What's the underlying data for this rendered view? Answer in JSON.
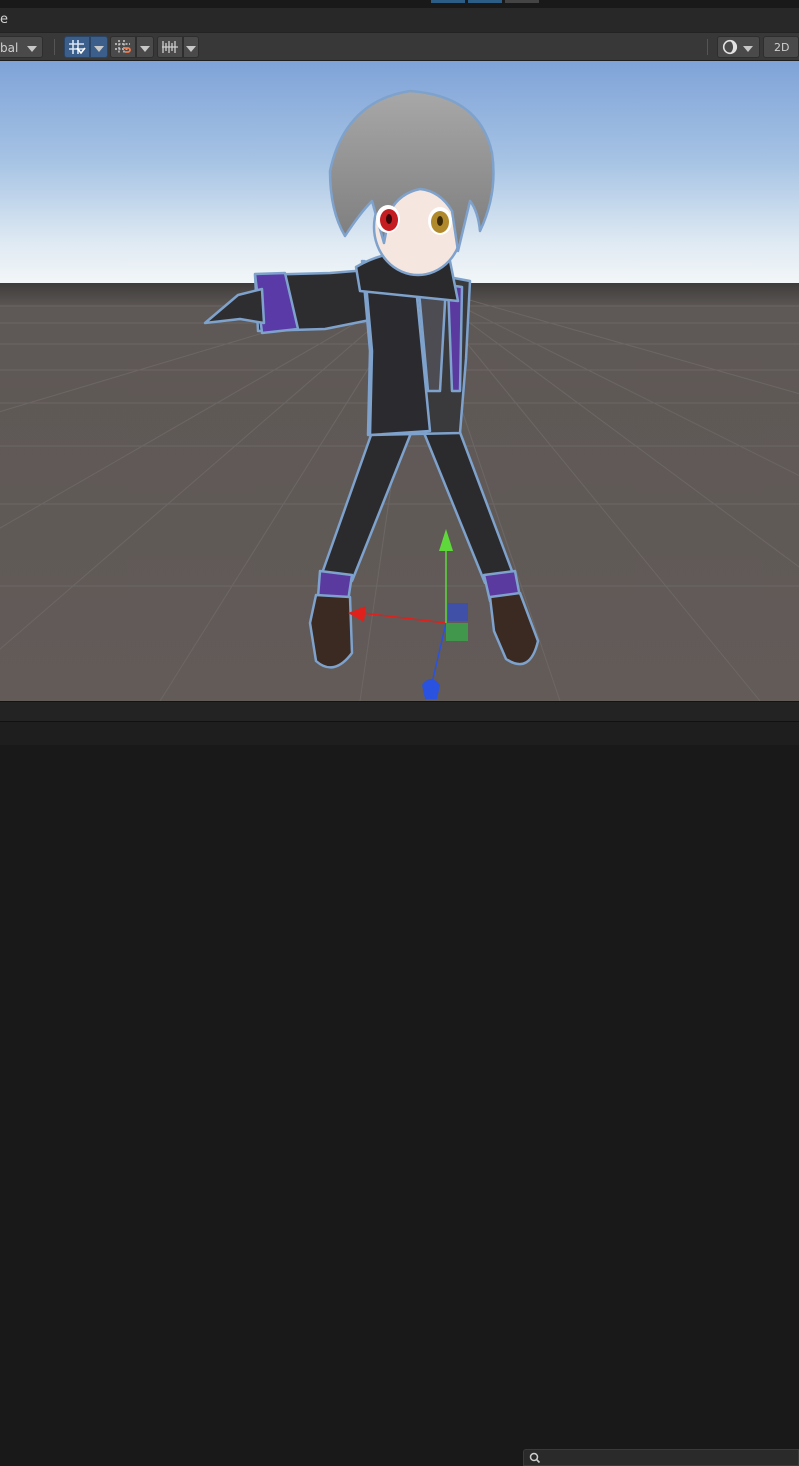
{
  "window": {
    "tab_title": "e"
  },
  "toolbar": {
    "pivot_rotation_label": "bal",
    "twod_label": "2D"
  },
  "search": {
    "placeholder": ""
  },
  "icons": {
    "grid_snap": "grid-snap-icon",
    "increment_snap": "increment-snap-icon",
    "view_tool_overlay": "overlay-icon",
    "shading": "shading-mode-icon",
    "search": "search-icon",
    "gizmo_x": "x-axis-arrow",
    "gizmo_y": "y-axis-arrow",
    "gizmo_z": "z-axis-arrow"
  },
  "colors": {
    "toolbar_bg": "#383838",
    "active_button": "#3c5e8a",
    "sky_top": "#7fa3d8",
    "horizon": "#eef4f8",
    "ground": "#5f5957",
    "gizmo_x": "#e0201b",
    "gizmo_y": "#5ed83a",
    "gizmo_z": "#2a52e0"
  }
}
